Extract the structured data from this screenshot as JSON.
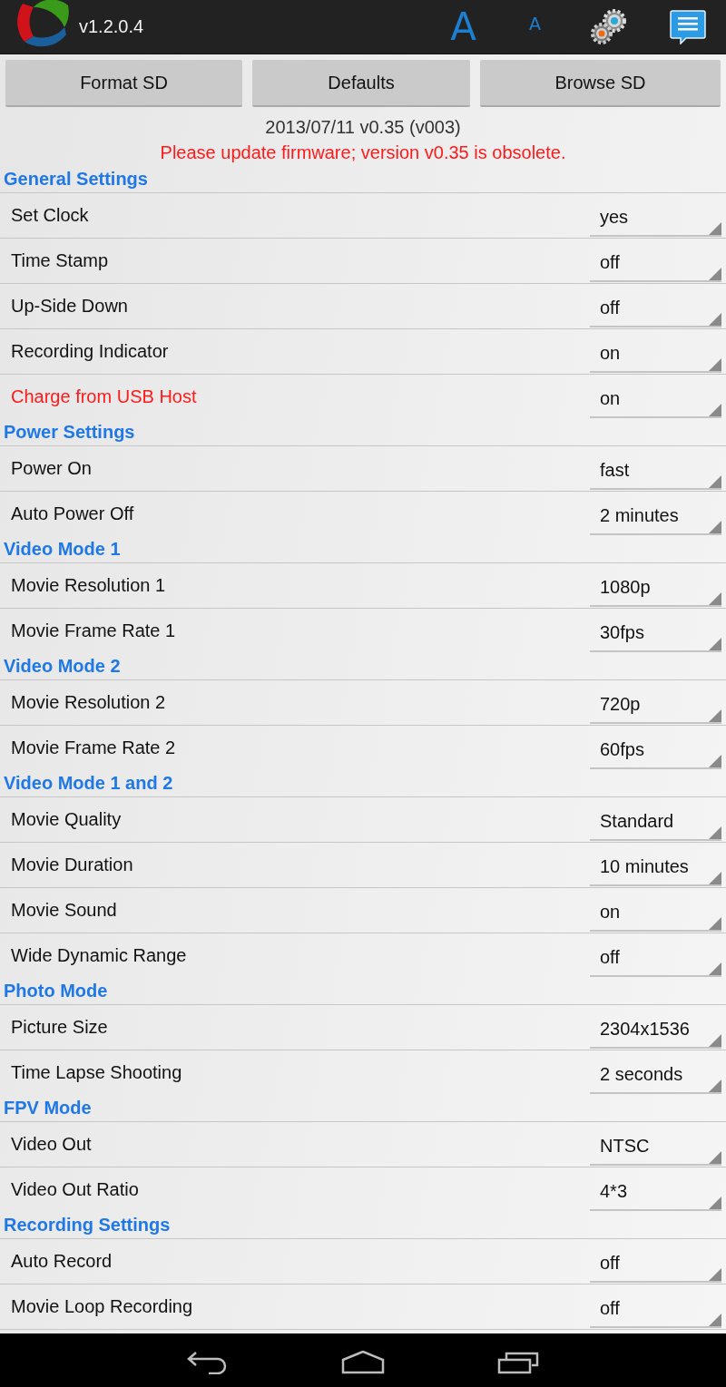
{
  "app_bar": {
    "version": "v1.2.0.4",
    "font_large": "A",
    "font_small": "A"
  },
  "buttons": [
    "Format SD",
    "Defaults",
    "Browse SD"
  ],
  "firmware": {
    "info": "2013/07/11 v0.35 (v003)",
    "warning": "Please update firmware; version v0.35 is obsolete."
  },
  "sections": [
    {
      "title": "General Settings",
      "rows": [
        {
          "label": "Set Clock",
          "value": "yes",
          "warning": false
        },
        {
          "label": "Time Stamp",
          "value": "off",
          "warning": false
        },
        {
          "label": "Up-Side Down",
          "value": "off",
          "warning": false
        },
        {
          "label": "Recording Indicator",
          "value": "on",
          "warning": false
        },
        {
          "label": "Charge from USB Host",
          "value": "on",
          "warning": true
        }
      ]
    },
    {
      "title": "Power Settings",
      "rows": [
        {
          "label": "Power On",
          "value": "fast",
          "warning": false
        },
        {
          "label": "Auto Power Off",
          "value": "2 minutes",
          "warning": false
        }
      ]
    },
    {
      "title": "Video Mode 1",
      "rows": [
        {
          "label": "Movie Resolution 1",
          "value": "1080p",
          "warning": false
        },
        {
          "label": "Movie Frame Rate 1",
          "value": "30fps",
          "warning": false
        }
      ]
    },
    {
      "title": "Video Mode 2",
      "rows": [
        {
          "label": "Movie Resolution 2",
          "value": "720p",
          "warning": false
        },
        {
          "label": "Movie Frame Rate 2",
          "value": "60fps",
          "warning": false
        }
      ]
    },
    {
      "title": "Video Mode 1 and 2",
      "rows": [
        {
          "label": "Movie Quality",
          "value": "Standard",
          "warning": false
        },
        {
          "label": "Movie Duration",
          "value": "10 minutes",
          "warning": false
        },
        {
          "label": "Movie Sound",
          "value": "on",
          "warning": false
        },
        {
          "label": "Wide Dynamic Range",
          "value": "off",
          "warning": false
        }
      ]
    },
    {
      "title": "Photo Mode",
      "rows": [
        {
          "label": "Picture Size",
          "value": "2304x1536",
          "warning": false
        },
        {
          "label": "Time Lapse Shooting",
          "value": "2 seconds",
          "warning": false
        }
      ]
    },
    {
      "title": "FPV Mode",
      "rows": [
        {
          "label": "Video Out",
          "value": "NTSC",
          "warning": false
        },
        {
          "label": "Video Out Ratio",
          "value": "4*3",
          "warning": false
        }
      ]
    },
    {
      "title": "Recording Settings",
      "rows": [
        {
          "label": "Auto Record",
          "value": "off",
          "warning": false
        },
        {
          "label": "Movie Loop Recording",
          "value": "off",
          "warning": false
        }
      ]
    }
  ]
}
